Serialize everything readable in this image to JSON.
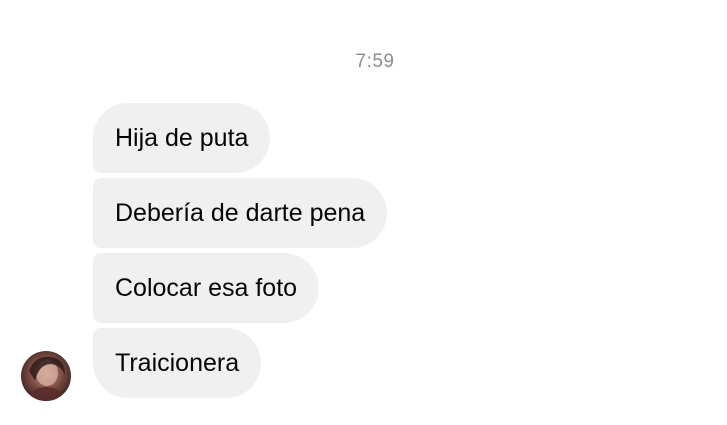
{
  "conversation": {
    "timestamp": "7:59",
    "messages": [
      {
        "text": "Hija de puta"
      },
      {
        "text": "Debería de darte pena"
      },
      {
        "text": "Colocar esa foto"
      },
      {
        "text": "Traicionera"
      }
    ]
  },
  "colors": {
    "bubble_background": "#f0f0f0",
    "timestamp_text": "#8a8d91",
    "message_text": "#050505"
  }
}
